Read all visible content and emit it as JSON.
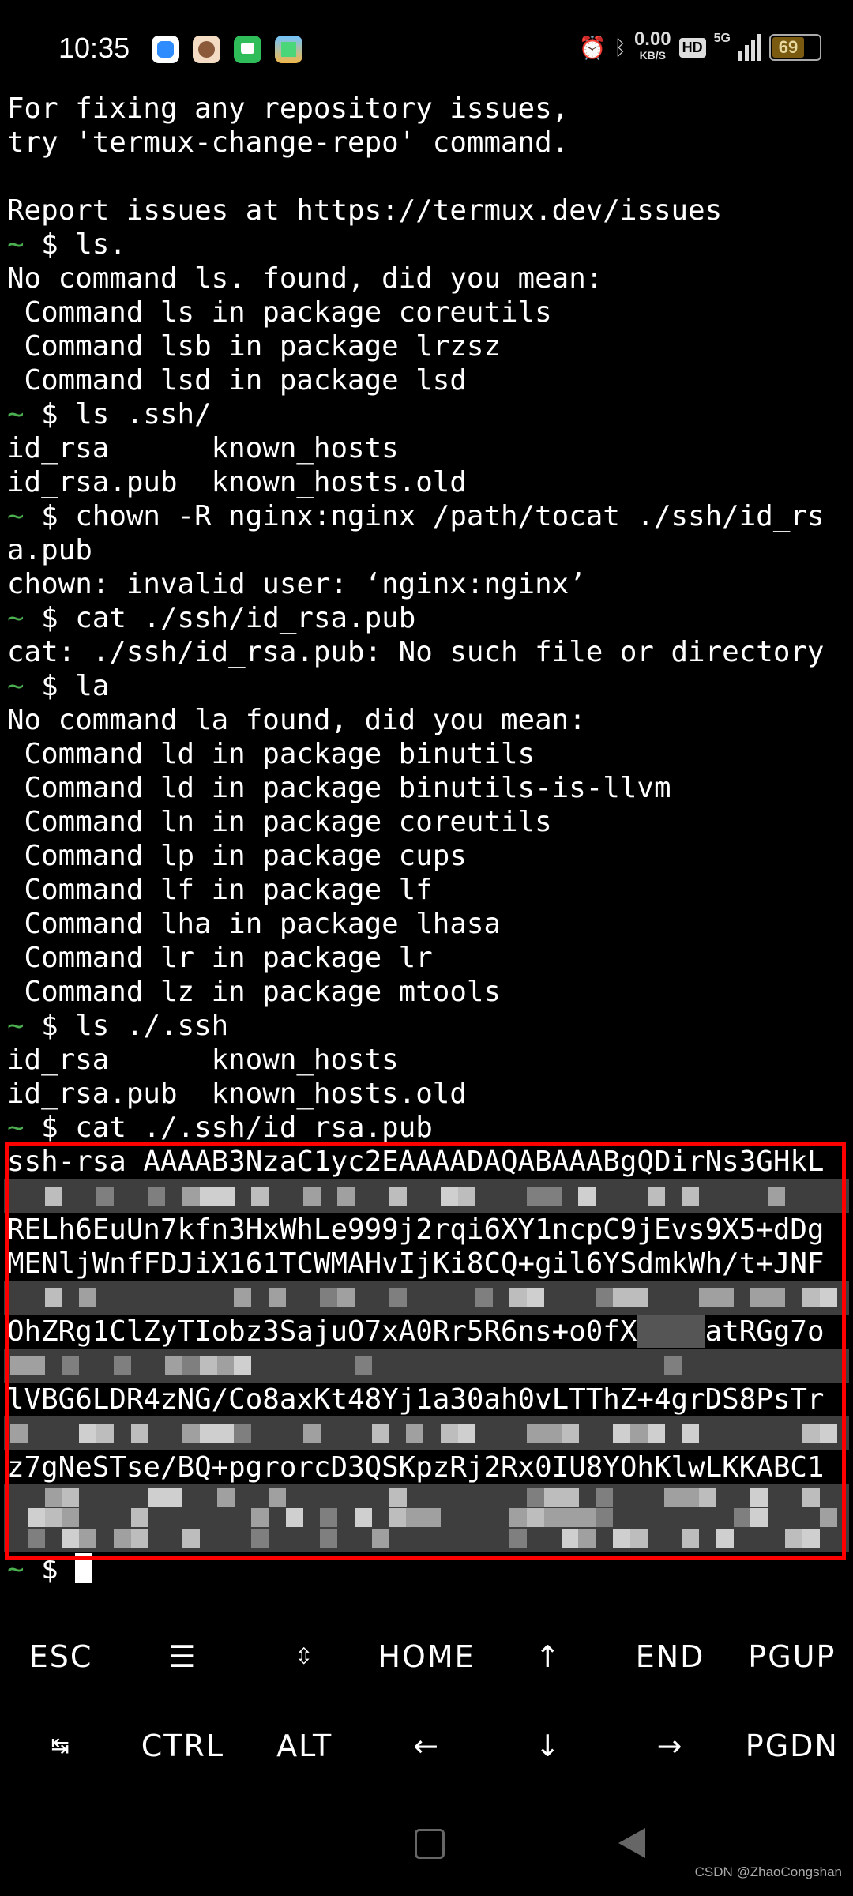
{
  "status_bar": {
    "time": "10:35",
    "app_icons": [
      "blue-app-icon",
      "monkey-app-icon",
      "messages-app-icon",
      "game-app-icon"
    ],
    "net_speed": "0.00",
    "net_speed_unit": "KB/S",
    "hd_label": "HD",
    "network_label": "5G",
    "battery": "69",
    "battery_level_percent": 69
  },
  "terminal": {
    "prompt_tilde": "~",
    "prompt_dollar": " $ ",
    "lines": [
      {
        "text": "For fixing any repository issues,"
      },
      {
        "text": "try 'termux-change-repo' command."
      },
      {
        "text": ""
      },
      {
        "text": "Report issues at https://termux.dev/issues"
      },
      {
        "prompt": true,
        "text": "ls."
      },
      {
        "text": "No command ls. found, did you mean:"
      },
      {
        "text": " Command ls in package coreutils"
      },
      {
        "text": " Command lsb in package lrzsz"
      },
      {
        "text": " Command lsd in package lsd"
      },
      {
        "prompt": true,
        "text": "ls .ssh/"
      },
      {
        "text": "id_rsa      known_hosts"
      },
      {
        "text": "id_rsa.pub  known_hosts.old"
      },
      {
        "prompt": true,
        "text": "chown -R nginx:nginx /path/tocat ./ssh/id_rs"
      },
      {
        "text": "a.pub"
      },
      {
        "text": "chown: invalid user: ‘nginx:nginx’"
      },
      {
        "prompt": true,
        "text": "cat ./ssh/id_rsa.pub"
      },
      {
        "text": "cat: ./ssh/id_rsa.pub: No such file or directory"
      },
      {
        "prompt": true,
        "text": "la"
      },
      {
        "text": "No command la found, did you mean:"
      },
      {
        "text": " Command ld in package binutils"
      },
      {
        "text": " Command ld in package binutils-is-llvm"
      },
      {
        "text": " Command ln in package coreutils"
      },
      {
        "text": " Command lp in package cups"
      },
      {
        "text": " Command lf in package lf"
      },
      {
        "text": " Command lha in package lhasa"
      },
      {
        "text": " Command lr in package lr"
      },
      {
        "text": " Command lz in package mtools"
      },
      {
        "prompt": true,
        "text": "ls ./.ssh"
      },
      {
        "text": "id_rsa      known_hosts"
      },
      {
        "text": "id_rsa.pub  known_hosts.old"
      },
      {
        "prompt": true,
        "text": "cat ./.ssh/id_rsa.pub"
      }
    ],
    "key_lines": [
      "ssh-rsa AAAAB3NzaC1yc2EAAAADAQABAAABgQDirNs3GHkL",
      "RELh6EuUn7kfn3HxWhLe999j2rqi6XY1ncpC9jEvs9X5+dDg",
      "MENljWnfFDJiX161TCWMAHvIjKi8CQ+gil6YSdmkWh/t+JNF",
      "OhZRg1ClZyTIobz3SajuO7xA0Rr5R6ns+o0fX",
      "atRGg7o",
      "lVBG6LDR4zNG/Co8axKt48Yj1a30ah0vLTThZ+4grDS8PsTr",
      "z7gNeSTse/BQ+pgrorcD3QSKpzRj2Rx0IU8YOhKlwLKKABC1"
    ],
    "highlight_color": "#ff0000"
  },
  "extra_keys": {
    "row1": [
      "ESC",
      "☰",
      "⇳",
      "HOME",
      "↑",
      "END",
      "PGUP"
    ],
    "row2": [
      "↹",
      "CTRL",
      "ALT",
      "←",
      "↓",
      "→",
      "PGDN"
    ]
  },
  "watermark": "CSDN @ZhaoCongshan"
}
